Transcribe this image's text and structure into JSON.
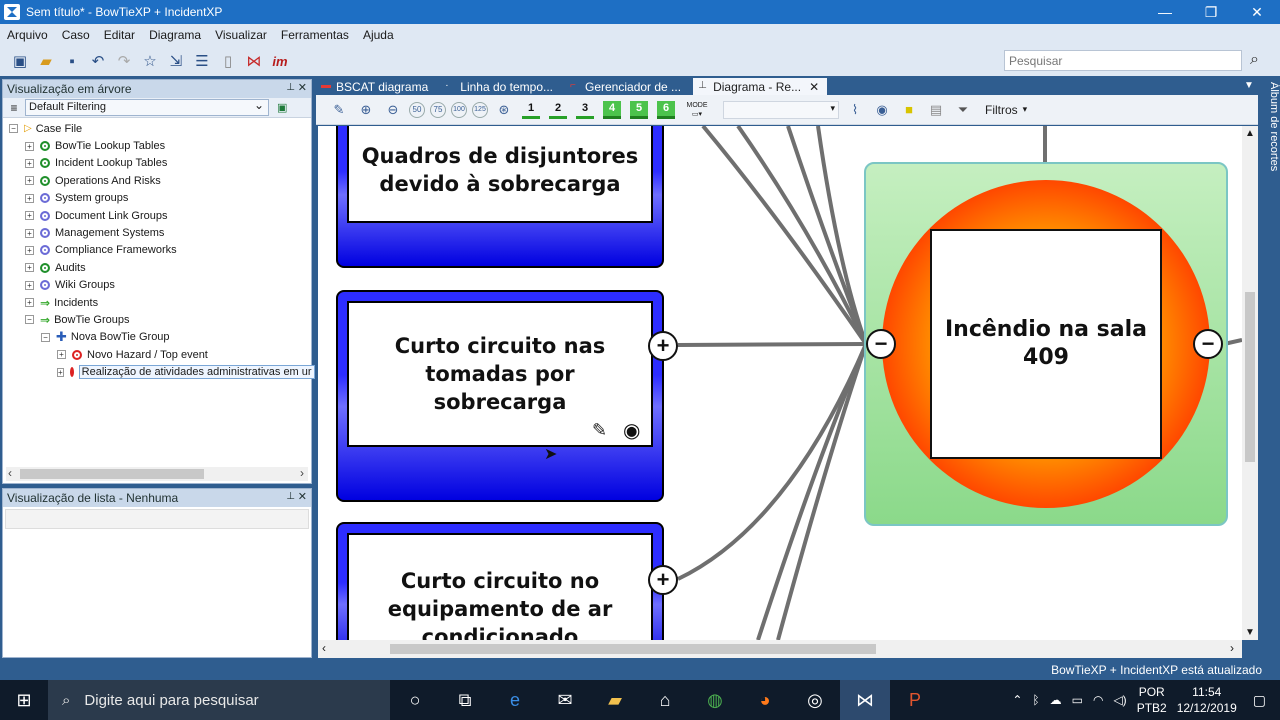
{
  "window": {
    "title": "Sem título* - BowTieXP + IncidentXP",
    "min": "—",
    "max": "❐",
    "close": "✕"
  },
  "menu": [
    "Arquivo",
    "Caso",
    "Editar",
    "Diagrama",
    "Visualizar",
    "Ferramentas",
    "Ajuda"
  ],
  "search": {
    "placeholder": "Pesquisar"
  },
  "tree_panel": {
    "title": "Visualização em árvore",
    "filter": "Default Filtering",
    "items": [
      {
        "label": "Case File",
        "icon": "triangle-icon",
        "depth": 0,
        "expander": "−"
      },
      {
        "label": "BowTie Lookup Tables",
        "icon": "green-dot-icon",
        "depth": 1,
        "expander": "+"
      },
      {
        "label": "Incident Lookup Tables",
        "icon": "green-dot-icon",
        "depth": 1,
        "expander": "+"
      },
      {
        "label": "Operations And Risks",
        "icon": "green-dot-icon",
        "depth": 1,
        "expander": "+"
      },
      {
        "label": "System groups",
        "icon": "blue-dot-icon",
        "depth": 1,
        "expander": "+"
      },
      {
        "label": "Document Link Groups",
        "icon": "blue-dot-icon",
        "depth": 1,
        "expander": "+"
      },
      {
        "label": "Management Systems",
        "icon": "blue-dot-icon",
        "depth": 1,
        "expander": "+"
      },
      {
        "label": "Compliance Frameworks",
        "icon": "blue-dot-icon",
        "depth": 1,
        "expander": "+"
      },
      {
        "label": "Audits",
        "icon": "green-dot-icon",
        "depth": 1,
        "expander": "+"
      },
      {
        "label": "Wiki Groups",
        "icon": "blue-dot-icon",
        "depth": 1,
        "expander": "+"
      },
      {
        "label": "Incidents",
        "icon": "green-arrow-icon",
        "depth": 1,
        "expander": "+"
      },
      {
        "label": "BowTie Groups",
        "icon": "green-arrow-icon",
        "depth": 1,
        "expander": "−"
      },
      {
        "label": "Nova BowTie Group",
        "icon": "blue-cross-icon",
        "depth": 2,
        "expander": "−"
      },
      {
        "label": "Novo Hazard / Top event",
        "icon": "red-dot-icon",
        "depth": 3,
        "expander": "+"
      },
      {
        "label": "Realização de atividades administrativas em ur",
        "icon": "red-dot-icon",
        "depth": 3,
        "expander": "+"
      }
    ]
  },
  "list_panel": {
    "title": "Visualização de lista - Nenhuma"
  },
  "tabs": [
    {
      "label": "BSCAT diagrama",
      "active": false
    },
    {
      "label": "Linha do tempo...",
      "active": false
    },
    {
      "label": "Gerenciador de ...",
      "active": false
    },
    {
      "label": "Diagrama - Re...",
      "active": true
    }
  ],
  "diagram_toolbar": {
    "zoom_levels": [
      "50",
      "75",
      "100",
      "125"
    ],
    "levels": [
      "1",
      "2",
      "3",
      "4",
      "5",
      "6"
    ],
    "mode_label": "MODE",
    "filters": "Filtros"
  },
  "diagram": {
    "threats": [
      "Quadros de disjuntores devido à sobrecarga",
      "Curto circuito nas tomadas por sobrecarga",
      "Curto circuito no equipamento de ar condicionado"
    ],
    "top_event": "Incêndio na sala 409",
    "colors": {
      "threat_blue": "#2d2dff",
      "event_red": "#ee1a00",
      "event_orange": "#ff9800",
      "event_bg": "#8bd98a"
    }
  },
  "album": "Álbum de recortes",
  "status": "BowTieXP + IncidentXP está atualizado",
  "taskbar": {
    "search_placeholder": "Digite aqui para pesquisar",
    "lang_top": "POR",
    "lang_bottom": "PTB2",
    "time": "11:54",
    "date": "12/12/2019"
  }
}
